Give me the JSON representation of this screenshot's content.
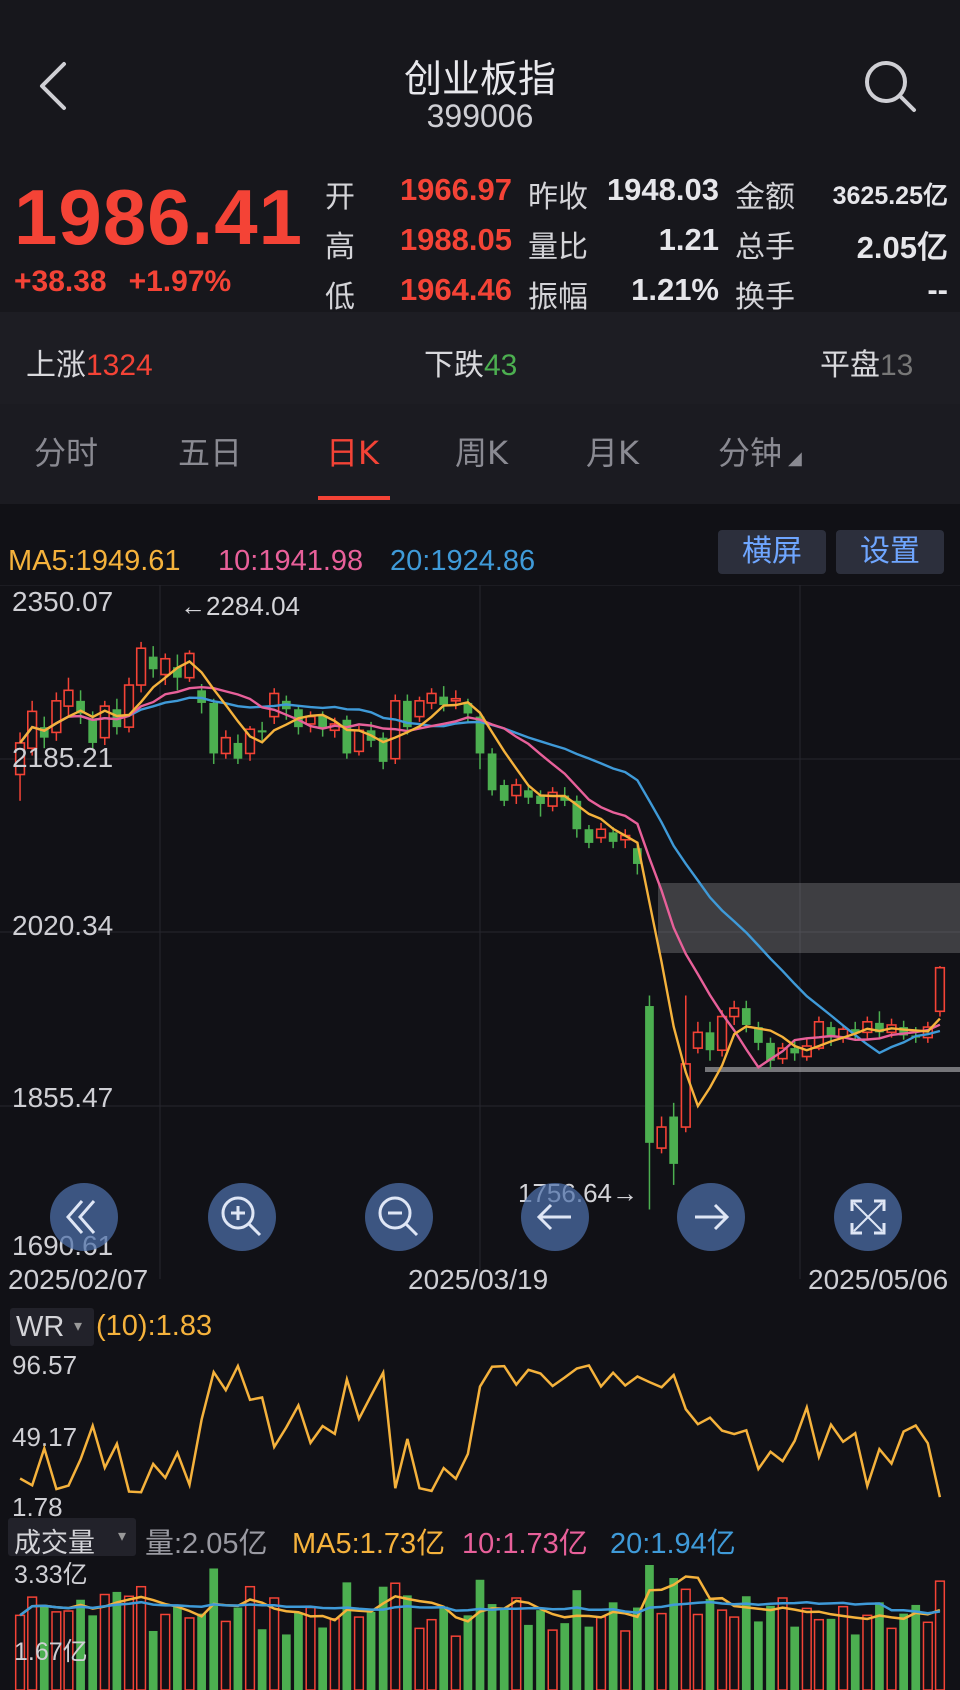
{
  "header": {
    "title": "创业板指",
    "code": "399006"
  },
  "quote": {
    "price": "1986.41",
    "change": "+38.38",
    "change_pct": "+1.97%",
    "open_label": "开",
    "open": "1966.97",
    "high_label": "高",
    "high": "1988.05",
    "low_label": "低",
    "low": "1964.46",
    "prev_close_label": "昨收",
    "prev_close": "1948.03",
    "vol_ratio_label": "量比",
    "vol_ratio": "1.21",
    "amplitude_label": "振幅",
    "amplitude": "1.21%",
    "amount_label": "金额",
    "amount": "3625.25亿",
    "total_hands_label": "总手",
    "total_hands": "2.05亿",
    "turnover_label": "换手",
    "turnover": "--"
  },
  "breadth": {
    "up_label": "上涨",
    "up": "1324",
    "down_label": "下跌",
    "down": "43",
    "flat_label": "平盘",
    "flat": "13"
  },
  "tabs": [
    {
      "label": "分时"
    },
    {
      "label": "五日"
    },
    {
      "label": "日K"
    },
    {
      "label": "周K"
    },
    {
      "label": "月K"
    },
    {
      "label": "分钟"
    }
  ],
  "ma_legend": {
    "ma5": "MA5:1949.61",
    "ma10": "10:1941.98",
    "ma20": "20:1924.86"
  },
  "buttons": {
    "landscape": "横屏",
    "settings": "设置"
  },
  "price_axis": [
    "2350.07",
    "2185.21",
    "2020.34",
    "1855.47",
    "1690.61"
  ],
  "date_axis": [
    "2025/02/07",
    "2025/03/19",
    "2025/05/06"
  ],
  "annotations": {
    "high": "2284.04",
    "low": "1756.64"
  },
  "wr": {
    "name": "WR",
    "value": "(10):1.83",
    "axis": [
      "96.57",
      "49.17",
      "1.78"
    ]
  },
  "volume": {
    "name": "成交量",
    "current": "量:2.05亿",
    "ma5": "MA5:1.73亿",
    "ma10": "10:1.73亿",
    "ma20": "20:1.94亿",
    "axis": [
      "3.33亿",
      "1.67亿"
    ]
  },
  "colors": {
    "up": "#f44336",
    "down": "#4caf50",
    "ma5": "#f5b23c",
    "ma10": "#e8609a",
    "ma20": "#3f9ad8",
    "accent": "#6fa6ff"
  },
  "chart_data": {
    "type": "candlestick",
    "ylim": [
      1690.61,
      2350.07
    ],
    "candles": [
      [
        2170,
        2200,
        2145,
        2210
      ],
      [
        2195,
        2230,
        2188,
        2240
      ],
      [
        2215,
        2205,
        2195,
        2225
      ],
      [
        2210,
        2240,
        2202,
        2248
      ],
      [
        2235,
        2250,
        2225,
        2262
      ],
      [
        2240,
        2228,
        2218,
        2250
      ],
      [
        2222,
        2200,
        2195,
        2230
      ],
      [
        2205,
        2235,
        2198,
        2240
      ],
      [
        2232,
        2215,
        2208,
        2242
      ],
      [
        2215,
        2255,
        2210,
        2262
      ],
      [
        2255,
        2290,
        2248,
        2296
      ],
      [
        2282,
        2270,
        2262,
        2292
      ],
      [
        2265,
        2280,
        2255,
        2285
      ],
      [
        2272,
        2262,
        2250,
        2284
      ],
      [
        2262,
        2285,
        2258,
        2288
      ],
      [
        2250,
        2238,
        2228,
        2256
      ],
      [
        2238,
        2190,
        2180,
        2242
      ],
      [
        2190,
        2205,
        2185,
        2212
      ],
      [
        2200,
        2185,
        2180,
        2208
      ],
      [
        2190,
        2213,
        2183,
        2216
      ],
      [
        2212,
        2210,
        2202,
        2220
      ],
      [
        2225,
        2247,
        2218,
        2252
      ],
      [
        2240,
        2232,
        2222,
        2245
      ],
      [
        2232,
        2215,
        2208,
        2236
      ],
      [
        2218,
        2225,
        2210,
        2230
      ],
      [
        2226,
        2214,
        2206,
        2230
      ],
      [
        2212,
        2218,
        2205,
        2224
      ],
      [
        2222,
        2190,
        2185,
        2226
      ],
      [
        2192,
        2212,
        2188,
        2216
      ],
      [
        2212,
        2202,
        2196,
        2220
      ],
      [
        2205,
        2182,
        2175,
        2210
      ],
      [
        2185,
        2240,
        2180,
        2246
      ],
      [
        2240,
        2215,
        2208,
        2246
      ],
      [
        2225,
        2240,
        2220,
        2244
      ],
      [
        2238,
        2247,
        2232,
        2252
      ],
      [
        2244,
        2236,
        2230,
        2254
      ],
      [
        2240,
        2242,
        2232,
        2250
      ],
      [
        2238,
        2228,
        2220,
        2242
      ],
      [
        2225,
        2190,
        2175,
        2230
      ],
      [
        2190,
        2155,
        2150,
        2195
      ],
      [
        2160,
        2145,
        2140,
        2165
      ],
      [
        2150,
        2160,
        2142,
        2166
      ],
      [
        2155,
        2148,
        2142,
        2160
      ],
      [
        2150,
        2142,
        2130,
        2155
      ],
      [
        2140,
        2153,
        2135,
        2158
      ],
      [
        2150,
        2145,
        2140,
        2158
      ],
      [
        2145,
        2118,
        2110,
        2150
      ],
      [
        2118,
        2105,
        2100,
        2122
      ],
      [
        2110,
        2118,
        2105,
        2124
      ],
      [
        2115,
        2106,
        2100,
        2120
      ],
      [
        2108,
        2112,
        2100,
        2118
      ],
      [
        2100,
        2085,
        2075,
        2106
      ],
      [
        1950,
        1820,
        1756.64,
        1960
      ],
      [
        1815,
        1835,
        1810,
        1845
      ],
      [
        1845,
        1800,
        1780,
        1858
      ],
      [
        1835,
        1895,
        1830,
        1960
      ],
      [
        1910,
        1925,
        1905,
        1935
      ],
      [
        1925,
        1908,
        1898,
        1935
      ],
      [
        1908,
        1940,
        1902,
        1946
      ],
      [
        1940,
        1948,
        1932,
        1955
      ],
      [
        1948,
        1932,
        1925,
        1955
      ],
      [
        1930,
        1915,
        1908,
        1935
      ],
      [
        1915,
        1898,
        1890,
        1920
      ],
      [
        1900,
        1910,
        1895,
        1915
      ],
      [
        1910,
        1905,
        1898,
        1918
      ],
      [
        1902,
        1912,
        1898,
        1920
      ],
      [
        1910,
        1935,
        1908,
        1940
      ],
      [
        1930,
        1920,
        1912,
        1935
      ],
      [
        1920,
        1928,
        1915,
        1932
      ],
      [
        1928,
        1924,
        1918,
        1935
      ],
      [
        1925,
        1935,
        1918,
        1940
      ],
      [
        1934,
        1925,
        1920,
        1945
      ],
      [
        1925,
        1932,
        1920,
        1938
      ],
      [
        1930,
        1922,
        1918,
        1936
      ],
      [
        1922,
        1920,
        1915,
        1930
      ],
      [
        1920,
        1930,
        1915,
        1935
      ],
      [
        1945,
        1986.41,
        1940,
        1988
      ]
    ]
  }
}
